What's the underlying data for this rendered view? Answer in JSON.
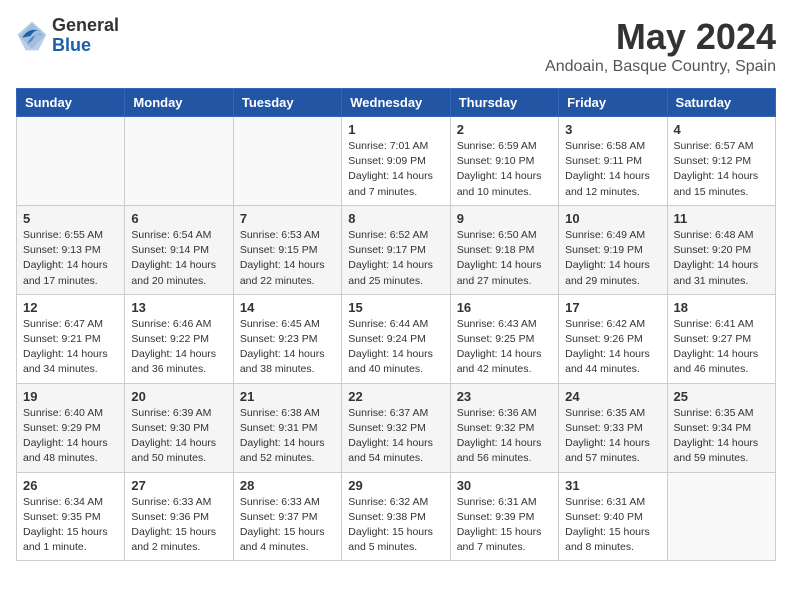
{
  "logo": {
    "general": "General",
    "blue": "Blue"
  },
  "title": "May 2024",
  "location": "Andoain, Basque Country, Spain",
  "weekdays": [
    "Sunday",
    "Monday",
    "Tuesday",
    "Wednesday",
    "Thursday",
    "Friday",
    "Saturday"
  ],
  "weeks": [
    [
      {
        "day": "",
        "info": ""
      },
      {
        "day": "",
        "info": ""
      },
      {
        "day": "",
        "info": ""
      },
      {
        "day": "1",
        "info": "Sunrise: 7:01 AM\nSunset: 9:09 PM\nDaylight: 14 hours\nand 7 minutes."
      },
      {
        "day": "2",
        "info": "Sunrise: 6:59 AM\nSunset: 9:10 PM\nDaylight: 14 hours\nand 10 minutes."
      },
      {
        "day": "3",
        "info": "Sunrise: 6:58 AM\nSunset: 9:11 PM\nDaylight: 14 hours\nand 12 minutes."
      },
      {
        "day": "4",
        "info": "Sunrise: 6:57 AM\nSunset: 9:12 PM\nDaylight: 14 hours\nand 15 minutes."
      }
    ],
    [
      {
        "day": "5",
        "info": "Sunrise: 6:55 AM\nSunset: 9:13 PM\nDaylight: 14 hours\nand 17 minutes."
      },
      {
        "day": "6",
        "info": "Sunrise: 6:54 AM\nSunset: 9:14 PM\nDaylight: 14 hours\nand 20 minutes."
      },
      {
        "day": "7",
        "info": "Sunrise: 6:53 AM\nSunset: 9:15 PM\nDaylight: 14 hours\nand 22 minutes."
      },
      {
        "day": "8",
        "info": "Sunrise: 6:52 AM\nSunset: 9:17 PM\nDaylight: 14 hours\nand 25 minutes."
      },
      {
        "day": "9",
        "info": "Sunrise: 6:50 AM\nSunset: 9:18 PM\nDaylight: 14 hours\nand 27 minutes."
      },
      {
        "day": "10",
        "info": "Sunrise: 6:49 AM\nSunset: 9:19 PM\nDaylight: 14 hours\nand 29 minutes."
      },
      {
        "day": "11",
        "info": "Sunrise: 6:48 AM\nSunset: 9:20 PM\nDaylight: 14 hours\nand 31 minutes."
      }
    ],
    [
      {
        "day": "12",
        "info": "Sunrise: 6:47 AM\nSunset: 9:21 PM\nDaylight: 14 hours\nand 34 minutes."
      },
      {
        "day": "13",
        "info": "Sunrise: 6:46 AM\nSunset: 9:22 PM\nDaylight: 14 hours\nand 36 minutes."
      },
      {
        "day": "14",
        "info": "Sunrise: 6:45 AM\nSunset: 9:23 PM\nDaylight: 14 hours\nand 38 minutes."
      },
      {
        "day": "15",
        "info": "Sunrise: 6:44 AM\nSunset: 9:24 PM\nDaylight: 14 hours\nand 40 minutes."
      },
      {
        "day": "16",
        "info": "Sunrise: 6:43 AM\nSunset: 9:25 PM\nDaylight: 14 hours\nand 42 minutes."
      },
      {
        "day": "17",
        "info": "Sunrise: 6:42 AM\nSunset: 9:26 PM\nDaylight: 14 hours\nand 44 minutes."
      },
      {
        "day": "18",
        "info": "Sunrise: 6:41 AM\nSunset: 9:27 PM\nDaylight: 14 hours\nand 46 minutes."
      }
    ],
    [
      {
        "day": "19",
        "info": "Sunrise: 6:40 AM\nSunset: 9:29 PM\nDaylight: 14 hours\nand 48 minutes."
      },
      {
        "day": "20",
        "info": "Sunrise: 6:39 AM\nSunset: 9:30 PM\nDaylight: 14 hours\nand 50 minutes."
      },
      {
        "day": "21",
        "info": "Sunrise: 6:38 AM\nSunset: 9:31 PM\nDaylight: 14 hours\nand 52 minutes."
      },
      {
        "day": "22",
        "info": "Sunrise: 6:37 AM\nSunset: 9:32 PM\nDaylight: 14 hours\nand 54 minutes."
      },
      {
        "day": "23",
        "info": "Sunrise: 6:36 AM\nSunset: 9:32 PM\nDaylight: 14 hours\nand 56 minutes."
      },
      {
        "day": "24",
        "info": "Sunrise: 6:35 AM\nSunset: 9:33 PM\nDaylight: 14 hours\nand 57 minutes."
      },
      {
        "day": "25",
        "info": "Sunrise: 6:35 AM\nSunset: 9:34 PM\nDaylight: 14 hours\nand 59 minutes."
      }
    ],
    [
      {
        "day": "26",
        "info": "Sunrise: 6:34 AM\nSunset: 9:35 PM\nDaylight: 15 hours\nand 1 minute."
      },
      {
        "day": "27",
        "info": "Sunrise: 6:33 AM\nSunset: 9:36 PM\nDaylight: 15 hours\nand 2 minutes."
      },
      {
        "day": "28",
        "info": "Sunrise: 6:33 AM\nSunset: 9:37 PM\nDaylight: 15 hours\nand 4 minutes."
      },
      {
        "day": "29",
        "info": "Sunrise: 6:32 AM\nSunset: 9:38 PM\nDaylight: 15 hours\nand 5 minutes."
      },
      {
        "day": "30",
        "info": "Sunrise: 6:31 AM\nSunset: 9:39 PM\nDaylight: 15 hours\nand 7 minutes."
      },
      {
        "day": "31",
        "info": "Sunrise: 6:31 AM\nSunset: 9:40 PM\nDaylight: 15 hours\nand 8 minutes."
      },
      {
        "day": "",
        "info": ""
      }
    ]
  ]
}
